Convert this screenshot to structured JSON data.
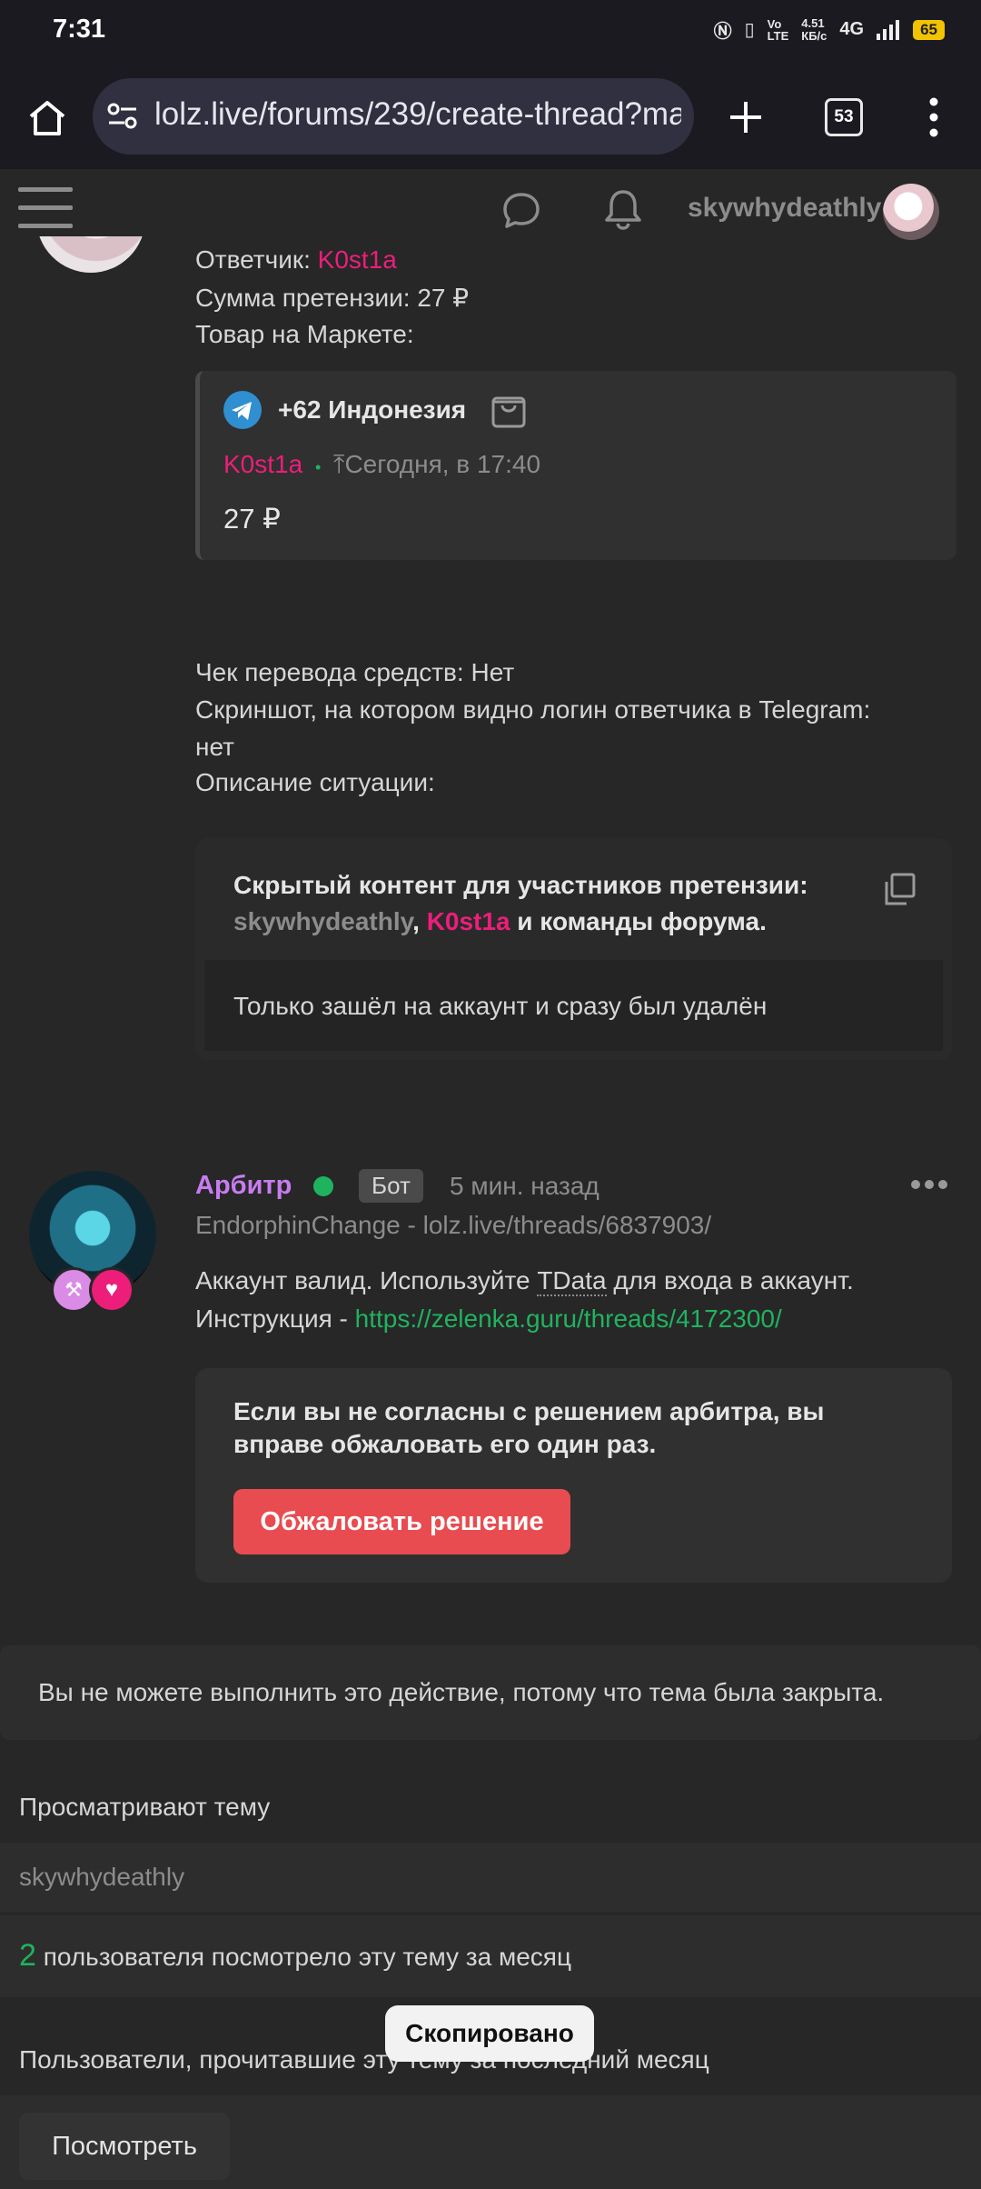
{
  "status_bar": {
    "time": "7:31",
    "net_speed": "4.51\nКБ/с",
    "network": "4G",
    "battery": "65"
  },
  "browser": {
    "url": "lolz.live/forums/239/create-thread?ma",
    "tab_count": "53"
  },
  "header": {
    "username": "skywhydeathly"
  },
  "claim": {
    "respondent_label": "Ответчик: ",
    "respondent": "K0st1a",
    "amount_line": "Сумма претензии: 27 ₽",
    "market_label": "Товар на Маркете:",
    "product": {
      "title": "+62 Индонезия",
      "seller": "K0st1a",
      "dot": "•",
      "date": "Сегодня, в 17:40",
      "price": "27 ₽"
    },
    "receipt_line": "Чек перевода средств: Нет",
    "screenshot_line1": "Скриншот, на котором видно логин ответчика в Telegram:",
    "screenshot_line2": "нет",
    "description_label": "Описание ситуации:",
    "hidden": {
      "title": "Скрытый контент для участников претензии:",
      "user1": "skywhydeathly",
      "comma": ", ",
      "user2": "K0st1a",
      "suffix": " и команды форума.",
      "body": "Только зашёл на аккаунт и сразу был удалён"
    }
  },
  "arbiter_post": {
    "name": "Арбитр",
    "badge": "Бот",
    "time": "5 мин. назад",
    "subtitle": "EndorphinChange - lolz.live/threads/6837903/",
    "text_prefix": "Аккаунт валид. Используйте ",
    "text_term": "TData",
    "text_suffix": " для входа в аккаунт.",
    "instruction_label": "Инструкция - ",
    "instruction_link": "https://zelenka.guru/threads/4172300/",
    "appeal_notice_line1": "Если вы не согласны с решением арбитра, вы",
    "appeal_notice_line2": "вправе обжаловать его один раз.",
    "appeal_button": "Обжаловать решение"
  },
  "closed_notice": "Вы не можете выполнить это действие, потому что тема была закрыта.",
  "viewing": {
    "title": "Просматривают тему",
    "user": "skywhydeathly",
    "count": "2",
    "count_text": " пользователя посмотрело эту тему за месяц",
    "readers_title": "Пользователи, прочитавшие эту тему за последний месяц",
    "view_button": "Посмотреть"
  },
  "toast": "Скопировано",
  "colors": {
    "accent_pink": "#ec1e7a",
    "accent_green": "#1fb35f",
    "button_red": "#e84c50",
    "arbiter_purple": "#c87cf0"
  }
}
